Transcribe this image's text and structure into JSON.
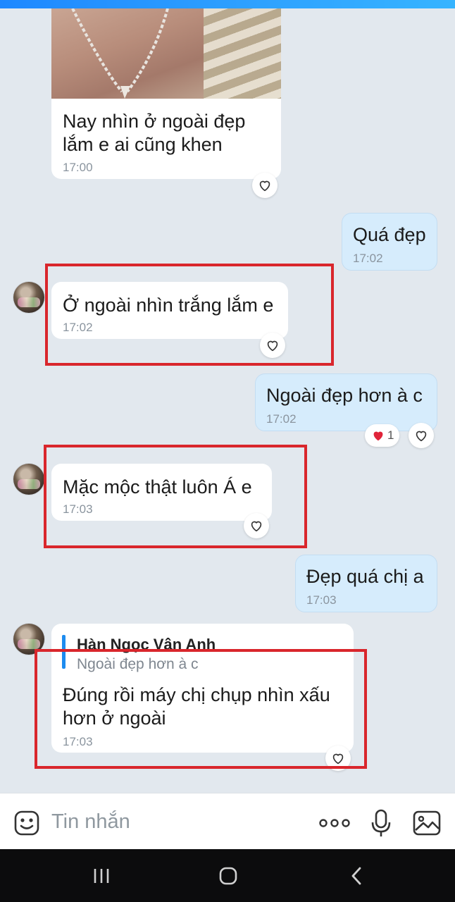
{
  "chat": {
    "messages": [
      {
        "id": "m1",
        "side": "in",
        "text_lines": [
          "Nay nhìn ở ngoài đẹp",
          "lắm e ai cũng khen"
        ],
        "time": "17:00"
      },
      {
        "id": "m2",
        "side": "out",
        "text": "Quá đẹp",
        "time": "17:02"
      },
      {
        "id": "m3",
        "side": "in",
        "text": "Ở ngoài nhìn trắng lắm e",
        "time": "17:02",
        "highlighted": true
      },
      {
        "id": "m4",
        "side": "out",
        "text": "Ngoài đẹp hơn à c",
        "time": "17:02",
        "reaction_count": "1"
      },
      {
        "id": "m5",
        "side": "in",
        "text": "Mặc mộc thật luôn Á e",
        "time": "17:03",
        "highlighted": true
      },
      {
        "id": "m6",
        "side": "out",
        "text": "Đẹp quá chị a",
        "time": "17:03"
      },
      {
        "id": "m7",
        "side": "in",
        "reply_name": "Hàn Ngọc Vân Anh",
        "reply_text": "Ngoài đẹp hơn à c",
        "text_lines": [
          "Đúng rồi máy chị chụp nhìn xấu",
          "hơn ở ngoài"
        ],
        "time": "17:03",
        "highlighted": true
      }
    ]
  },
  "composer": {
    "placeholder": "Tin nhắn",
    "icons": [
      "emoji-icon",
      "more-icon",
      "microphone-icon",
      "image-icon"
    ]
  },
  "colors": {
    "highlight": "#d9262c",
    "outgoing": "#d6ecfc",
    "incoming": "#ffffff",
    "accent": "#1d8cf0",
    "heart": "#e0243a"
  },
  "navbar": {
    "icons": [
      "recents-icon",
      "home-icon",
      "back-icon"
    ]
  }
}
